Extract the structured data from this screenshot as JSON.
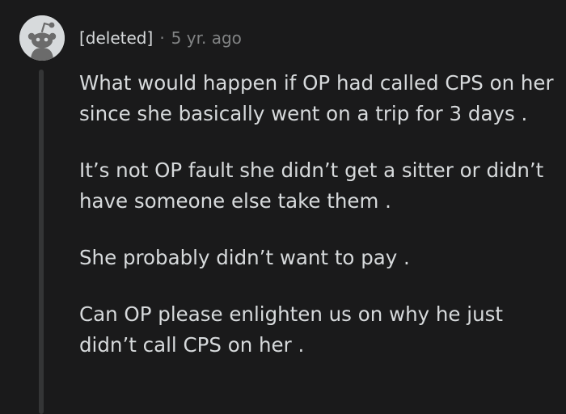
{
  "comment": {
    "author": "[deleted]",
    "separator": "·",
    "age": "5 yr. ago",
    "avatar_icon": "reddit-snoo-icon",
    "paragraphs": [
      "What would happen if OP had called CPS on her since she basically went on a trip for 3 days .",
      "It’s not OP fault she didn’t get a sitter or didn’t have someone else take them .",
      "She probably didn’t want to pay .",
      "Can OP please enlighten us on why he just didn’t call CPS on her ."
    ]
  },
  "colors": {
    "background": "#1a1a1b",
    "text": "#d7dadc",
    "muted": "#818384",
    "thread_line": "#343536",
    "avatar_bg": "#d7dadc",
    "snoo": "#6b6b6b"
  }
}
